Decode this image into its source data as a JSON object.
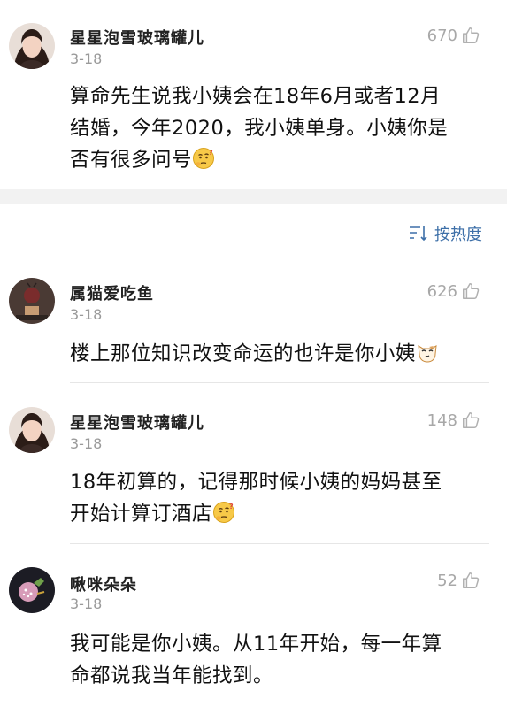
{
  "sort": {
    "label": "按热度"
  },
  "comments": [
    {
      "name": "星星泡雪玻璃罐儿",
      "date": "3-18",
      "likes": "670",
      "text": [
        "算命先生说我小姨会在18年6月或者12月",
        "结婚，今年2020，我小姨单身。小姨你是",
        "否有很多问号"
      ]
    },
    {
      "name": "属猫爱吃鱼",
      "date": "3-18",
      "likes": "626",
      "text": [
        "楼上那位知识改变命运的也许是你小姨"
      ]
    },
    {
      "name": "星星泡雪玻璃罐儿",
      "date": "3-18",
      "likes": "148",
      "text": [
        "18年初算的，记得那时候小姨的妈妈甚至",
        "开始计算订酒店"
      ]
    },
    {
      "name": "啾咪朵朵",
      "date": "3-18",
      "likes": "52",
      "text": [
        "我可能是你小姨。从11年开始，每一年算",
        "命都说我当年能找到。"
      ]
    }
  ],
  "colors": {
    "accent": "#3d6fa8",
    "muted": "#9a9a9a",
    "band": "#f2f2f2"
  }
}
